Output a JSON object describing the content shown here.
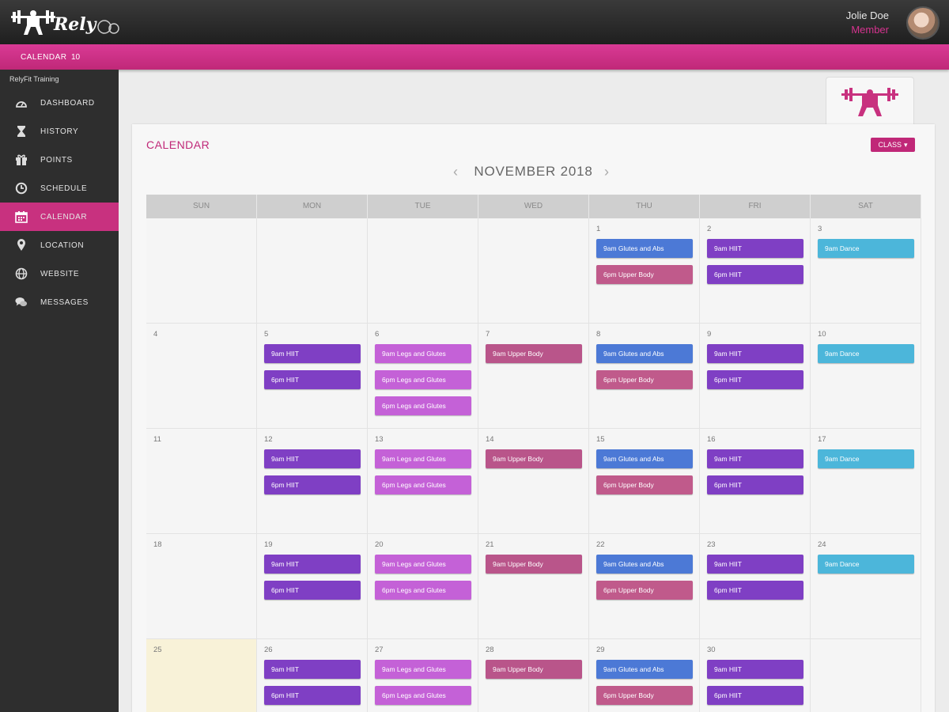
{
  "header": {
    "brand": "Rely",
    "user_name": "Jolie Doe",
    "user_role": "Member"
  },
  "breadcrumb": {
    "label": "CALENDAR",
    "count": "10"
  },
  "sidebar": {
    "title": "RelyFit Training",
    "items": [
      {
        "label": "DASHBOARD",
        "icon": "dashboard-icon",
        "active": false
      },
      {
        "label": "HISTORY",
        "icon": "hourglass-icon",
        "active": false
      },
      {
        "label": "POINTS",
        "icon": "gift-icon",
        "active": false
      },
      {
        "label": "SCHEDULE",
        "icon": "clock-icon",
        "active": false
      },
      {
        "label": "CALENDAR",
        "icon": "calendar-icon",
        "active": true
      },
      {
        "label": "LOCATION",
        "icon": "map-pin-icon",
        "active": false
      },
      {
        "label": "WEBSITE",
        "icon": "globe-icon",
        "active": false
      },
      {
        "label": "MESSAGES",
        "icon": "chat-icon",
        "active": false
      }
    ]
  },
  "calendar": {
    "title": "CALENDAR",
    "filter_label": "CLASS",
    "month": "NOVEMBER 2018",
    "weekdays": [
      "SUN",
      "MON",
      "TUE",
      "WED",
      "THU",
      "FRI",
      "SAT"
    ],
    "today": 25,
    "first_weekday": 4,
    "days_in_month": 30,
    "visible_rows": 5
  },
  "colors": {
    "primary": "#c8317f",
    "hiit": "#7f3fc4",
    "legs": "#c461d7",
    "upper": "#b9558a",
    "glutes_abs": "#4c79d6",
    "upper_thu": "#c05a8b",
    "dance": "#4cb6da"
  },
  "schedule": {
    "SUN": [],
    "MON": [
      {
        "text": "9am HIIT",
        "color": "hiit"
      },
      {
        "text": "6pm HIIT",
        "color": "hiit"
      }
    ],
    "TUE": [
      {
        "text": "9am Legs and Glutes",
        "color": "legs"
      },
      {
        "text": "6pm Legs and Glutes",
        "color": "legs"
      }
    ],
    "WED": [
      {
        "text": "9am Upper Body",
        "color": "upper"
      }
    ],
    "THU": [
      {
        "text": "9am Glutes and Abs",
        "color": "glutes_abs"
      },
      {
        "text": "6pm Upper Body",
        "color": "upper_thu"
      }
    ],
    "FRI": [
      {
        "text": "9am HIIT",
        "color": "hiit"
      },
      {
        "text": "6pm HIIT",
        "color": "hiit"
      }
    ],
    "SAT": [
      {
        "text": "9am Dance",
        "color": "dance"
      }
    ]
  },
  "extra_events": {
    "6": [
      {
        "text": "6pm Legs and Glutes",
        "color": "legs"
      }
    ]
  }
}
